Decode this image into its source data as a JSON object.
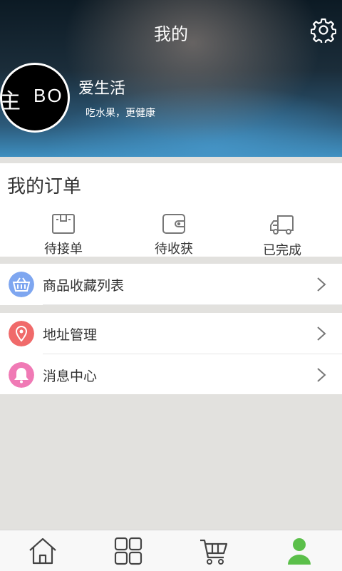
{
  "header": {
    "title": "我的"
  },
  "user": {
    "avatar_text_left": "主",
    "avatar_text_right": "BO",
    "name": "爱生活",
    "subtitle": "吃水果，更健康"
  },
  "orders": {
    "title": "我的订单",
    "items": [
      {
        "label": "待接单",
        "icon": "box-icon"
      },
      {
        "label": "待收获",
        "icon": "wallet-icon"
      },
      {
        "label": "已完成",
        "icon": "truck-icon"
      }
    ]
  },
  "menu": {
    "favorites": {
      "label": "商品收藏列表",
      "icon": "basket-icon",
      "color": "#7ea6f0"
    },
    "address": {
      "label": "地址管理",
      "icon": "location-pin-icon",
      "color": "#f06a6a"
    },
    "messages": {
      "label": "消息中心",
      "icon": "bell-icon",
      "color": "#f07ab5"
    }
  },
  "tabbar": {
    "items": [
      "home-icon",
      "grid-icon",
      "cart-icon",
      "person-icon"
    ],
    "active_color": "#5bbf4a"
  }
}
